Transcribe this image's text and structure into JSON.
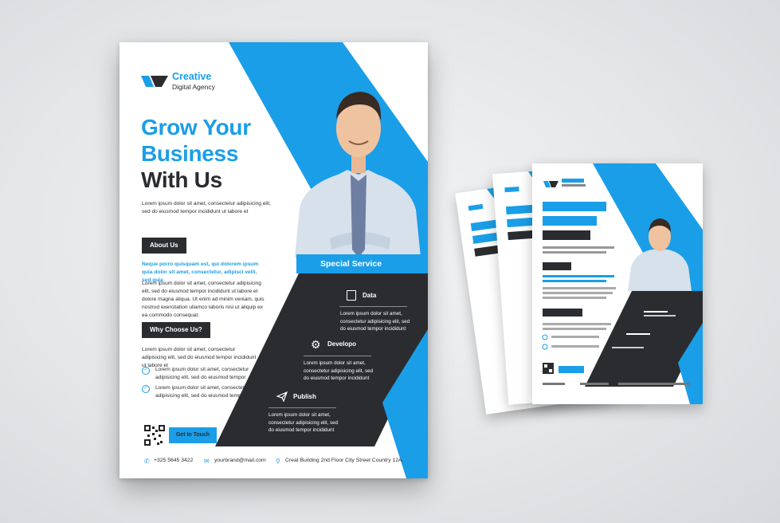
{
  "brand": {
    "name": "Creative",
    "tagline": "Digital Agency"
  },
  "headline": {
    "line1": "Grow Your",
    "line2": "Business",
    "line3": "With Us"
  },
  "intro": "Lorem ipsum dolor sit amet, consectetur adipisicing elit, sed do eiusmod tempor incididunt ut labore et",
  "about": {
    "label": "About Us",
    "highlight": "Neque porro quisquam est, qui dolorem ipsum quia dolor sit amet, consectetur, adipisci velit, sed quia",
    "body": "Lorem ipsum dolor sit amet, consectetur adipisicing elit, sed do eiusmod tempor incididunt ut labore et dolore magna aliqua. Ut enim ad minim veniam, quis nostrud exercitation ullamco laboris nisi ut aliquip ex ea commodo consequat."
  },
  "why": {
    "label": "Why Choose Us?",
    "body": "Lorem ipsum dolor sit amet, consectetur adipisicing elit, sed do eiusmod tempor incididunt ut labore et",
    "points": [
      "Lorem ipsum dolor sit amet, consectetur adipisicing elit, sed do eiusmod tempor",
      "Lorem ipsum dolor sit amet, consectetur adipisicing elit, sed do eiusmod tempor"
    ]
  },
  "special_service": "Special Service",
  "services": [
    {
      "title": "Data",
      "icon": "document-icon",
      "text": "Lorem ipsum dolor sit amet, consectetur adipisicing elit, sed do eiusmod tempor incididunt"
    },
    {
      "title": "Developo",
      "icon": "gear-icon",
      "text": "Lorem ipsum dolor sit amet, consectetur adipisicing elit, sed do eiusmod tempor incididunt"
    },
    {
      "title": "Publish",
      "icon": "paper-plane-icon",
      "text": "Lorem ipsum dolor sit amet, consectetur adipisicing elit, sed do eiusmod tempor incididunt"
    }
  ],
  "cta": "Get In Touch",
  "contact": {
    "phone": "+325 5645 3422",
    "email": "yourbrand@mail.com",
    "address": "Creat Building 2nd Floor City Street Country 12A."
  },
  "colors": {
    "accent": "#1a9ee8",
    "dark": "#2b2c30",
    "background": "#e6e8ea"
  }
}
